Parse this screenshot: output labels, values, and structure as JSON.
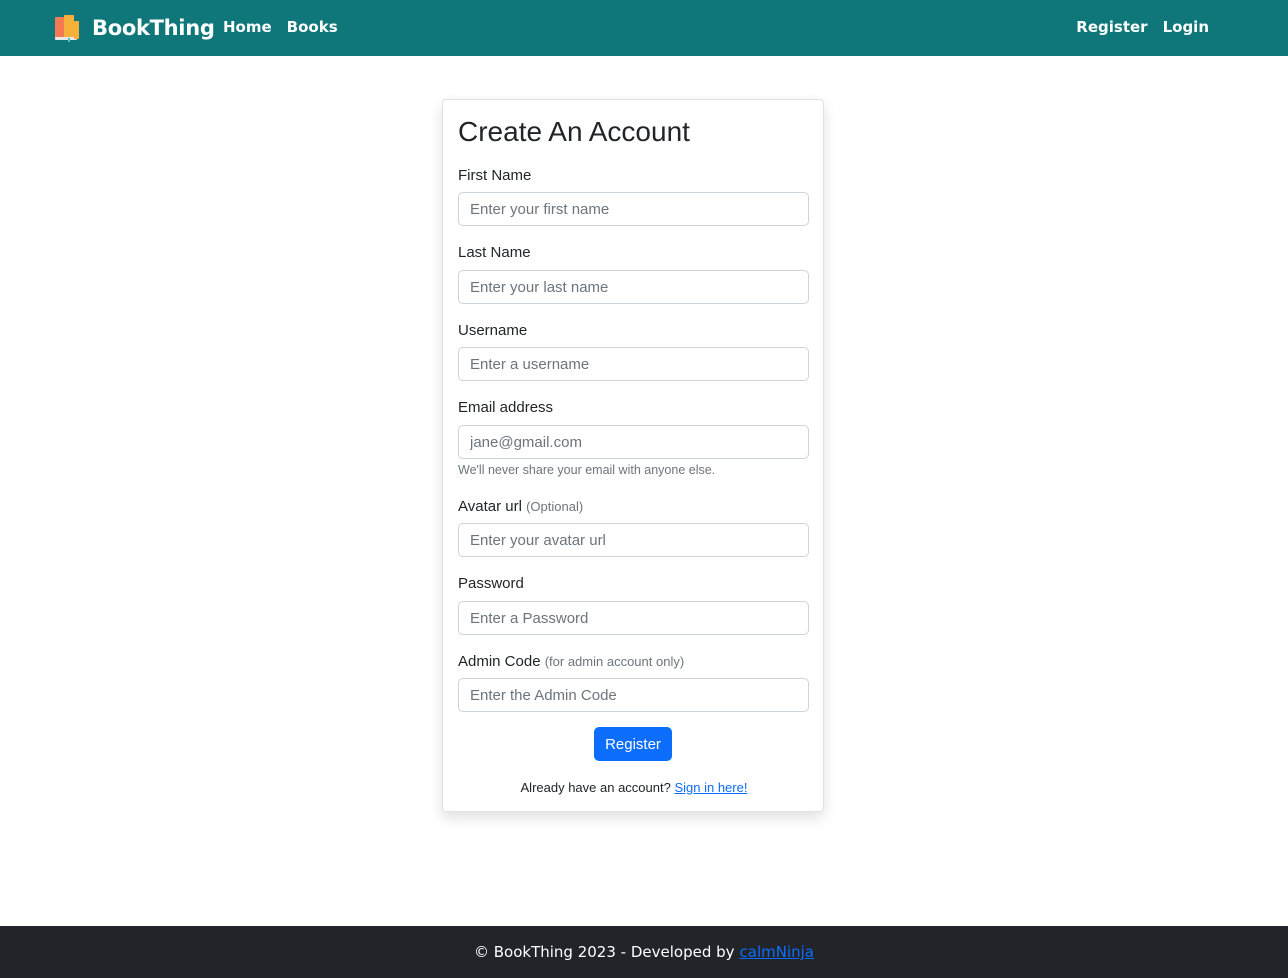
{
  "navbar": {
    "brand": "BookThing",
    "brand_icon": "books-icon",
    "left_links": [
      "Home",
      "Books"
    ],
    "right_links": [
      "Register",
      "Login"
    ],
    "bg_color": "#0f7679"
  },
  "form": {
    "title": "Create An Account",
    "first_name": {
      "label": "First Name",
      "placeholder": "Enter your first name"
    },
    "last_name": {
      "label": "Last Name",
      "placeholder": "Enter your last name"
    },
    "username": {
      "label": "Username",
      "placeholder": "Enter a username"
    },
    "email": {
      "label": "Email address",
      "placeholder": "jane@gmail.com",
      "help": "We'll never share your email with anyone else."
    },
    "avatar": {
      "label": "Avatar url",
      "note": "(Optional)",
      "placeholder": "Enter your avatar url"
    },
    "password": {
      "label": "Password",
      "placeholder": "Enter a Password"
    },
    "admin_code": {
      "label": "Admin Code",
      "note": "(for admin account only)",
      "placeholder": "Enter the Admin Code"
    },
    "submit_label": "Register",
    "signin_prompt": "Already have an account?",
    "signin_link": "Sign in here!"
  },
  "footer": {
    "text": "© BookThing 2023 - Developed by",
    "author_link": "calmNinja"
  },
  "colors": {
    "primary": "#0d6efd",
    "footer_bg": "#212529"
  }
}
